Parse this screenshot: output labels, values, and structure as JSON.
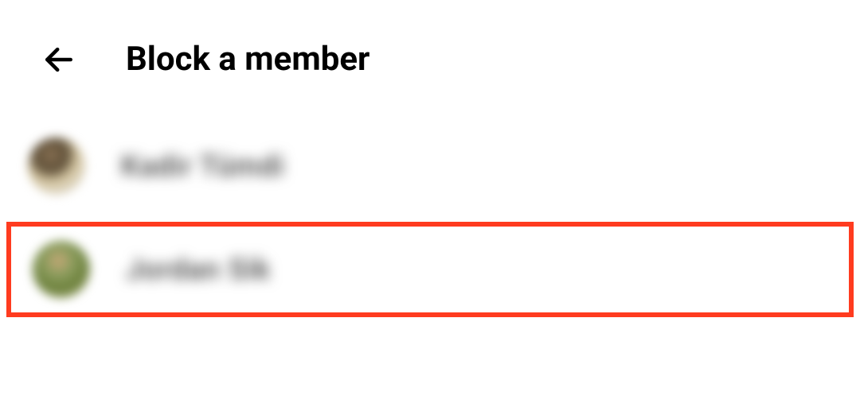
{
  "header": {
    "title": "Block a member"
  },
  "members": [
    {
      "name": "Kadir Tümdi",
      "highlighted": false
    },
    {
      "name": "Jordan Sik",
      "highlighted": true
    }
  ]
}
